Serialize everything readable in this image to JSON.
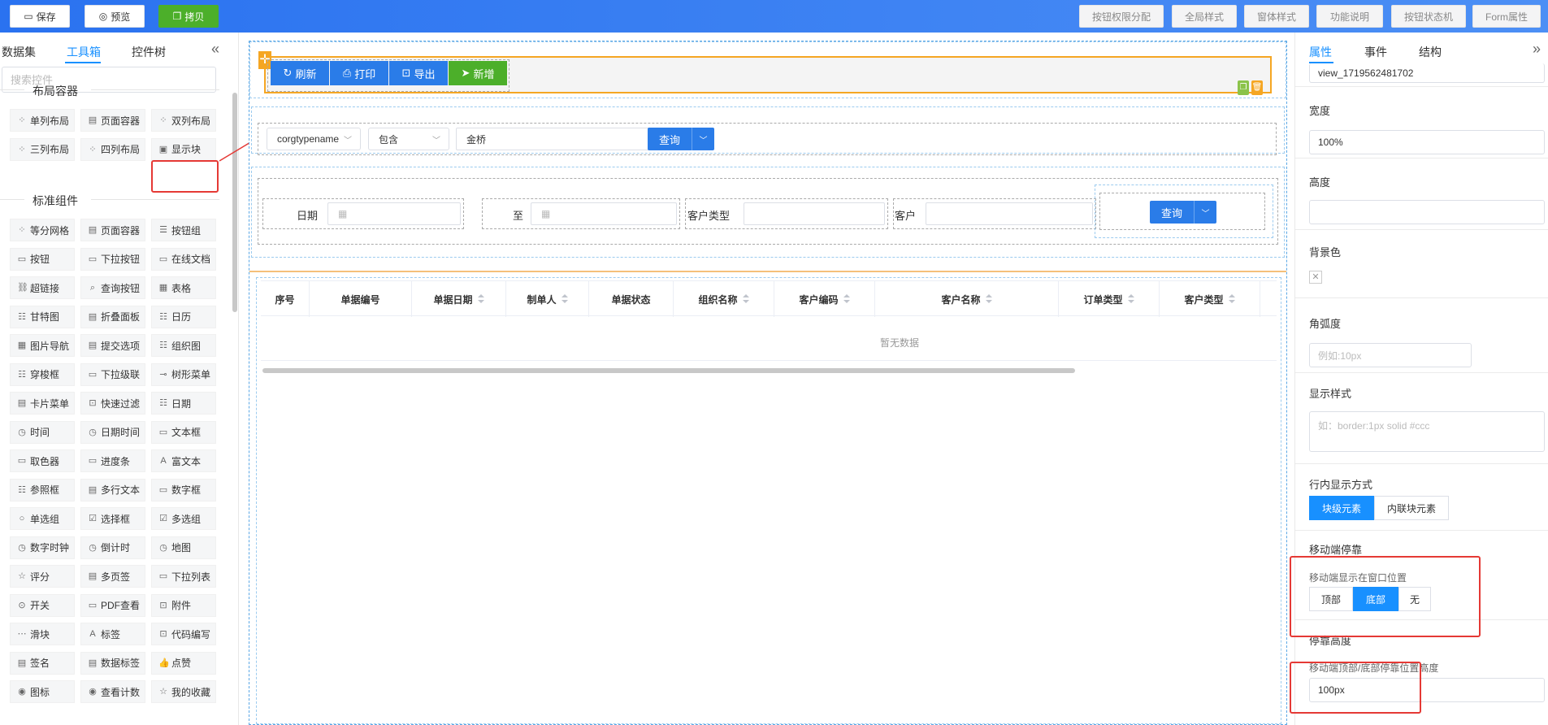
{
  "toolbar": {
    "save": "保存",
    "preview": "预览",
    "copy": "拷贝",
    "right_buttons": [
      "按钮权限分配",
      "全局样式",
      "窗体样式",
      "功能说明",
      "按钮状态机",
      "Form属性"
    ]
  },
  "left_panel": {
    "tabs": [
      "数据集",
      "工具箱",
      "控件树"
    ],
    "active_tab": "工具箱",
    "search_placeholder": "搜索控件",
    "sections": [
      {
        "title": "布局容器",
        "items": [
          "单列布局",
          "页面容器",
          "双列布局",
          "三列布局",
          "四列布局",
          "显示块"
        ]
      },
      {
        "title": "标准组件",
        "items": [
          "等分网格",
          "页面容器",
          "按钮组",
          "按钮",
          "下拉按钮",
          "在线文档",
          "超链接",
          "查询按钮",
          "表格",
          "甘特图",
          "折叠面板",
          "日历",
          "图片导航",
          "提交选项",
          "组织图",
          "穿梭框",
          "下拉级联",
          "树形菜单",
          "卡片菜单",
          "快速过滤",
          "日期",
          "时间",
          "日期时间",
          "文本框",
          "取色器",
          "进度条",
          "富文本",
          "参照框",
          "多行文本",
          "数字框",
          "单选组",
          "选择框",
          "多选组",
          "数字时钟",
          "倒计时",
          "地图",
          "评分",
          "多页签",
          "下拉列表",
          "开关",
          "PDF查看",
          "附件",
          "滑块",
          "标签",
          "代码编写",
          "签名",
          "数据标签",
          "点赞",
          "图标",
          "查看计数",
          "我的收藏"
        ]
      }
    ]
  },
  "canvas": {
    "action_buttons": [
      "刷新",
      "打印",
      "导出",
      "新增"
    ],
    "filter": {
      "field": "corgtypename",
      "op": "包含",
      "value": "金桥",
      "query": "查询"
    },
    "form": {
      "date_label": "日期",
      "to_label": "至",
      "cust_type_label": "客户类型",
      "cust_label": "客户",
      "query": "查询"
    },
    "table": {
      "columns": [
        "序号",
        "单据编号",
        "单据日期",
        "制单人",
        "单据状态",
        "组织名称",
        "客户编码",
        "客户名称",
        "订单类型",
        "客户类型"
      ],
      "sortable": [
        false,
        false,
        true,
        true,
        false,
        true,
        true,
        true,
        true,
        true
      ],
      "empty_text": "暂无数据"
    }
  },
  "right_panel": {
    "tabs": [
      "属性",
      "事件",
      "结构"
    ],
    "active_tab": "属性",
    "id_value": "view_1719562481702",
    "width_label": "宽度",
    "width_value": "100%",
    "height_label": "高度",
    "bg_label": "背景色",
    "radius_label": "角弧度",
    "radius_placeholder": "例如:10px",
    "style_label": "显示样式",
    "style_placeholder": "如：border:1px solid #ccc",
    "inline_label": "行内显示方式",
    "inline_options": [
      "块级元素",
      "内联块元素"
    ],
    "inline_selected": 0,
    "mobile_dock_label": "移动端停靠",
    "mobile_pos_label": "移动端显示在窗口位置",
    "mobile_pos_options": [
      "顶部",
      "底部",
      "无"
    ],
    "mobile_pos_selected": 1,
    "dock_height_label": "停靠高度",
    "dock_height_sub": "移动端顶部/底部停靠位置高度",
    "dock_height_value": "100px"
  },
  "colors": {
    "primary": "#1890ff",
    "button_blue": "#2a7ce8",
    "green": "#4caf2a",
    "highlight_red": "#e53935",
    "selected_orange": "#f5a623"
  }
}
